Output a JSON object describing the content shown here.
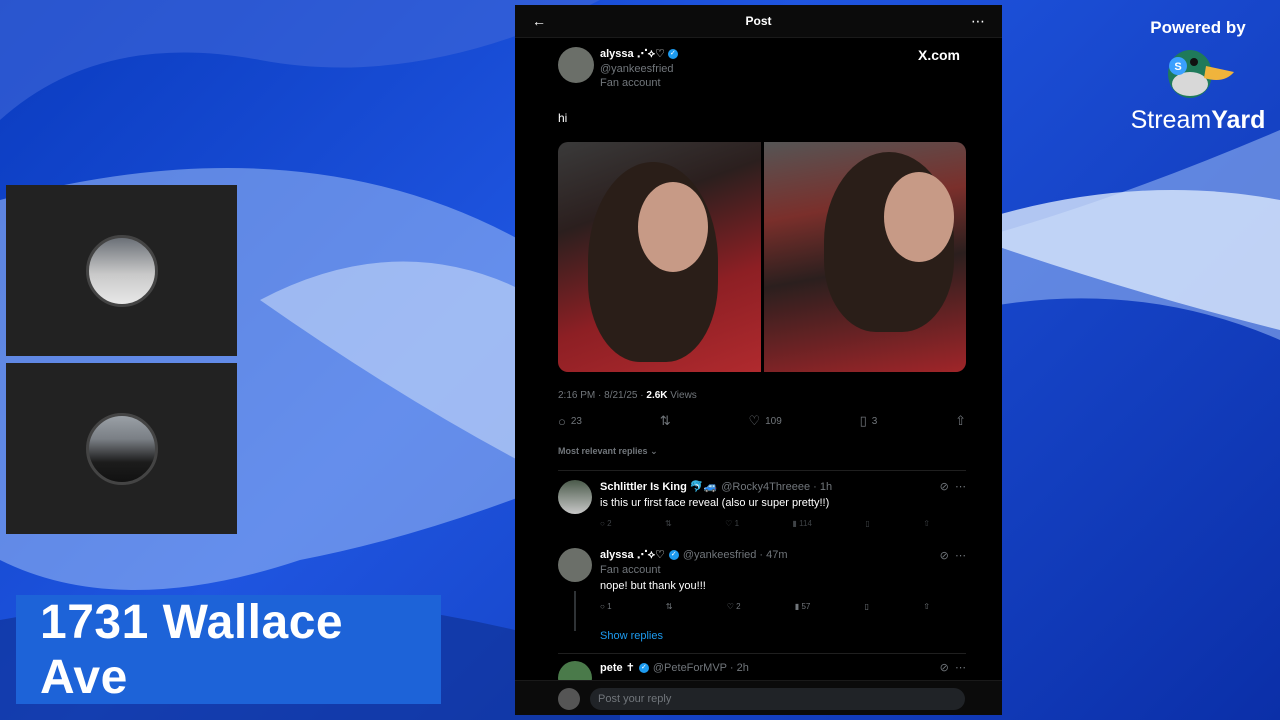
{
  "lower_third": {
    "title": "1731 Wallace Ave"
  },
  "branding": {
    "powered_by": "Powered by",
    "brand_stream": "Stream",
    "brand_yard": "Yard"
  },
  "post": {
    "header_title": "Post",
    "author": {
      "name": "alyssa ⋰⟡♡",
      "handle": "@yankeesfried",
      "label": "Fan account"
    },
    "site": "X.com",
    "text": "hi",
    "timestamp": "2:16 PM · 8/21/25 ·",
    "views_count": "2.6K",
    "views_label": "Views",
    "stats": {
      "replies": "23",
      "likes": "109",
      "bookmarks": "3"
    },
    "relevant_label": "Most relevant replies",
    "reply_placeholder": "Post your reply"
  },
  "replies": [
    {
      "name": "Schlittler Is King 🐬🚙",
      "meta": "@Rocky4Threeee · 1h",
      "text": "is this ur first face reveal (also ur super pretty!!)",
      "stats": {
        "replies": "2",
        "retweets": "",
        "likes": "1",
        "views": "114"
      }
    },
    {
      "name": "alyssa ⋰⟡♡",
      "meta": "@yankeesfried · 47m",
      "label": "Fan account",
      "text": "nope! but thank you!!!",
      "stats": {
        "replies": "1",
        "retweets": "",
        "likes": "2",
        "views": "57"
      },
      "show_replies": "Show replies"
    },
    {
      "name": "pete ✝︎",
      "meta": "@PeteForMVP · 2h"
    }
  ],
  "icons": {
    "back": "←",
    "more": "⋯",
    "reply": "○",
    "retweet": "⇅",
    "like": "♡",
    "bookmark": "▯",
    "share": "⇧",
    "views": "▮",
    "grok": "⊘",
    "verified": "✓"
  }
}
